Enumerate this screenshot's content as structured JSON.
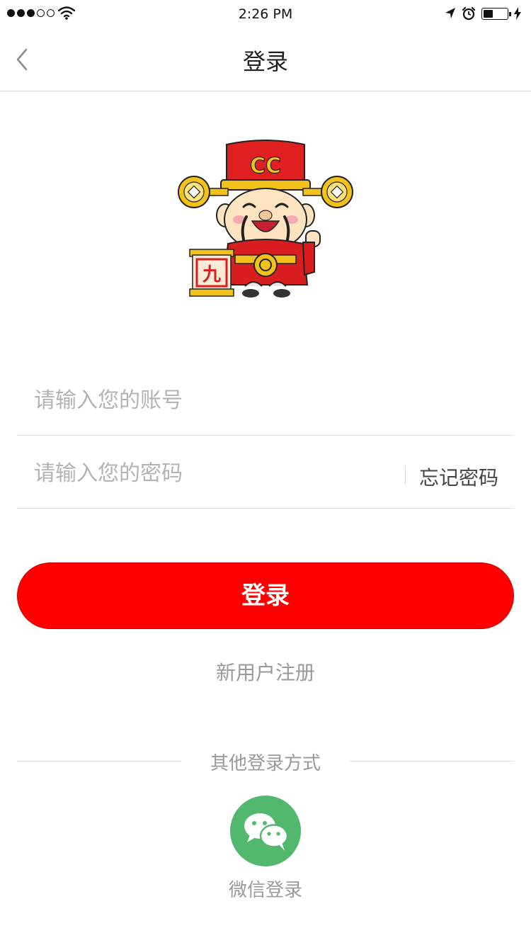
{
  "status_bar": {
    "time": "2:26 PM",
    "signal_bars_filled": 3,
    "signal_bars_total": 5,
    "battery_level": 0.4
  },
  "nav": {
    "title": "登录",
    "back_icon": "chevron-left-icon"
  },
  "mascot": {
    "name": "mascot-god-of-wealth",
    "hat_text": "CC",
    "scroll_text": "九"
  },
  "form": {
    "account_placeholder": "请输入您的账号",
    "password_placeholder": "请输入您的密码",
    "forgot_password_label": "忘记密码"
  },
  "login_button_label": "登录",
  "register_label": "新用户注册",
  "other_login": {
    "title": "其他登录方式",
    "wechat_label": "微信登录",
    "wechat_icon": "wechat-icon"
  },
  "colors": {
    "primary_red": "#ff0000",
    "wechat_green": "#51b86e",
    "muted_text": "#9a9a9a"
  }
}
